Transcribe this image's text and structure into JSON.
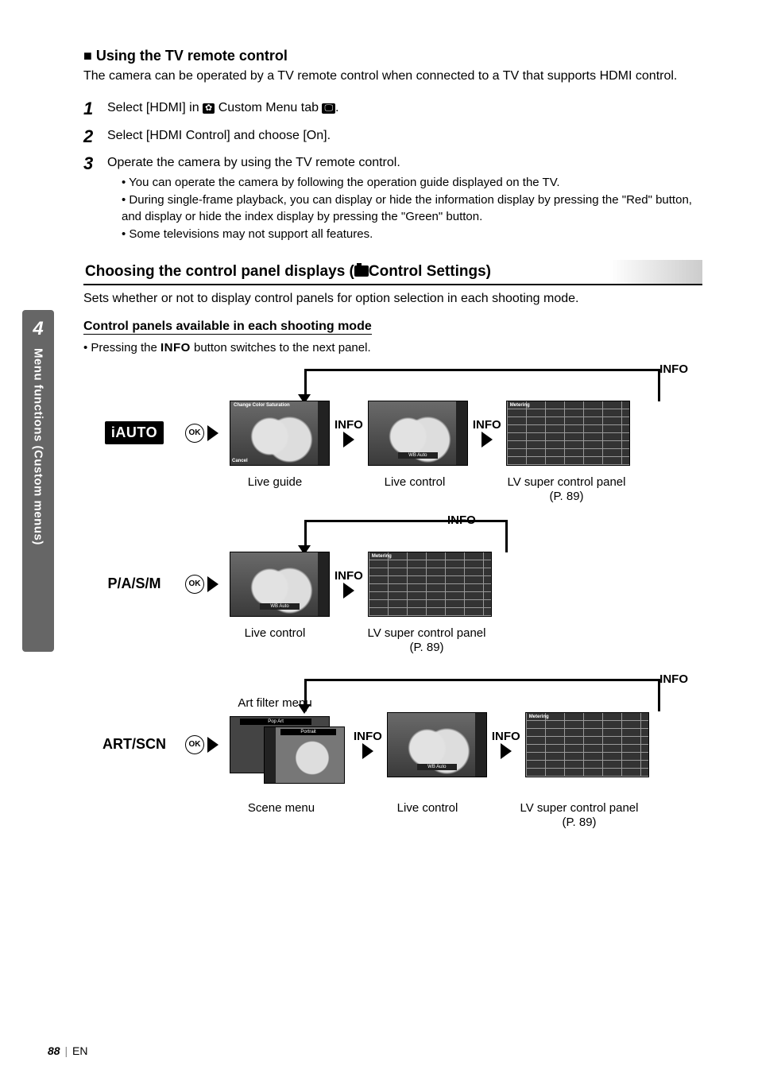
{
  "sideTab": {
    "num": "4",
    "text": "Menu functions (Custom menus)"
  },
  "sec1": {
    "title": "Using the TV remote control",
    "intro": "The camera can be operated by a TV remote control when connected to a TV that supports HDMI control.",
    "steps": [
      {
        "num": "1",
        "pre": "Select [HDMI] in ",
        "iconA": "✿",
        "mid": " Custom Menu tab ",
        "iconB": "D",
        "post": "."
      },
      {
        "num": "2",
        "text": "Select [HDMI Control] and choose [On]."
      },
      {
        "num": "3",
        "text": "Operate the camera by using the TV remote control.",
        "subs": [
          "You can operate the camera by following the operation guide displayed on the TV.",
          "During single-frame playback, you can display or hide the information display by pressing the \"Red\" button, and display or hide the index display by pressing the \"Green\" button.",
          "Some televisions may not support all features."
        ]
      }
    ]
  },
  "sec2": {
    "title_pre": "Choosing the control panel displays (",
    "title_post": "Control Settings)",
    "intro": "Sets whether or not to display control panels for option selection in each shooting mode.",
    "subhead": "Control panels available in each shooting mode",
    "bullet_pre": "Pressing the ",
    "bullet_info": "INFO",
    "bullet_post": " button switches to the next panel."
  },
  "labels": {
    "ok": "OK",
    "info": "INFO",
    "iauto": "iAUTO",
    "pasm": "P/A/S/M",
    "artscn": "ART/SCN",
    "live_guide": "Live guide",
    "live_control": "Live control",
    "lv_super": "LV super control panel (P. 89)",
    "art_filter_menu": "Art filter menu",
    "scene_menu": "Scene menu",
    "change_color": "Change Color Saturation",
    "cancel": "Cancel",
    "wb_auto": "WB Auto",
    "metering": "Metering",
    "pop_art": "Pop Art",
    "portrait": "Portrait"
  },
  "footer": {
    "page": "88",
    "lang": "EN"
  }
}
